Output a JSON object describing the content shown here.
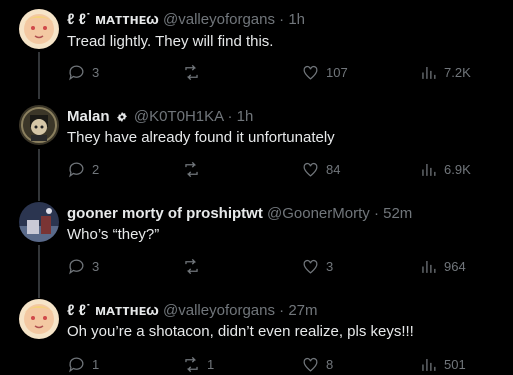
{
  "tweets": [
    {
      "name": "ℓ   ℓ˙ ᴍᴀᴛᴛʜᴇω",
      "handle": "@valleyoforgans",
      "dot_time": "· 1h",
      "text": "Tread lightly. They will find this.",
      "replies": "3",
      "retweets": "",
      "likes": "107",
      "views": "7.2K"
    },
    {
      "name": "Malan",
      "handle": "@K0T0H1KA",
      "dot_time": "· 1h",
      "text": "They have already found it unfortunately",
      "replies": "2",
      "retweets": "",
      "likes": "84",
      "views": "6.9K"
    },
    {
      "name": "gooner morty of proshiptwt",
      "handle": "@GoonerMorty",
      "dot_time": "· 52m",
      "text": "Who’s “they?”",
      "replies": "3",
      "retweets": "",
      "likes": "3",
      "views": "964"
    },
    {
      "name": "ℓ   ℓ˙ ᴍᴀᴛᴛʜᴇω",
      "handle": "@valleyoforgans",
      "dot_time": "· 27m",
      "text": "Oh you’re a shotacon, didn’t even realize, pls keys!!!",
      "replies": "1",
      "retweets": "1",
      "likes": "8",
      "views": "501"
    }
  ],
  "colors": {
    "background": "#000000",
    "text": "#e7e9ea",
    "muted": "#71767b",
    "thread_line": "#333639"
  },
  "icons": [
    "reply-icon",
    "retweet-icon",
    "like-icon",
    "views-icon",
    "verified-badge-icon"
  ]
}
